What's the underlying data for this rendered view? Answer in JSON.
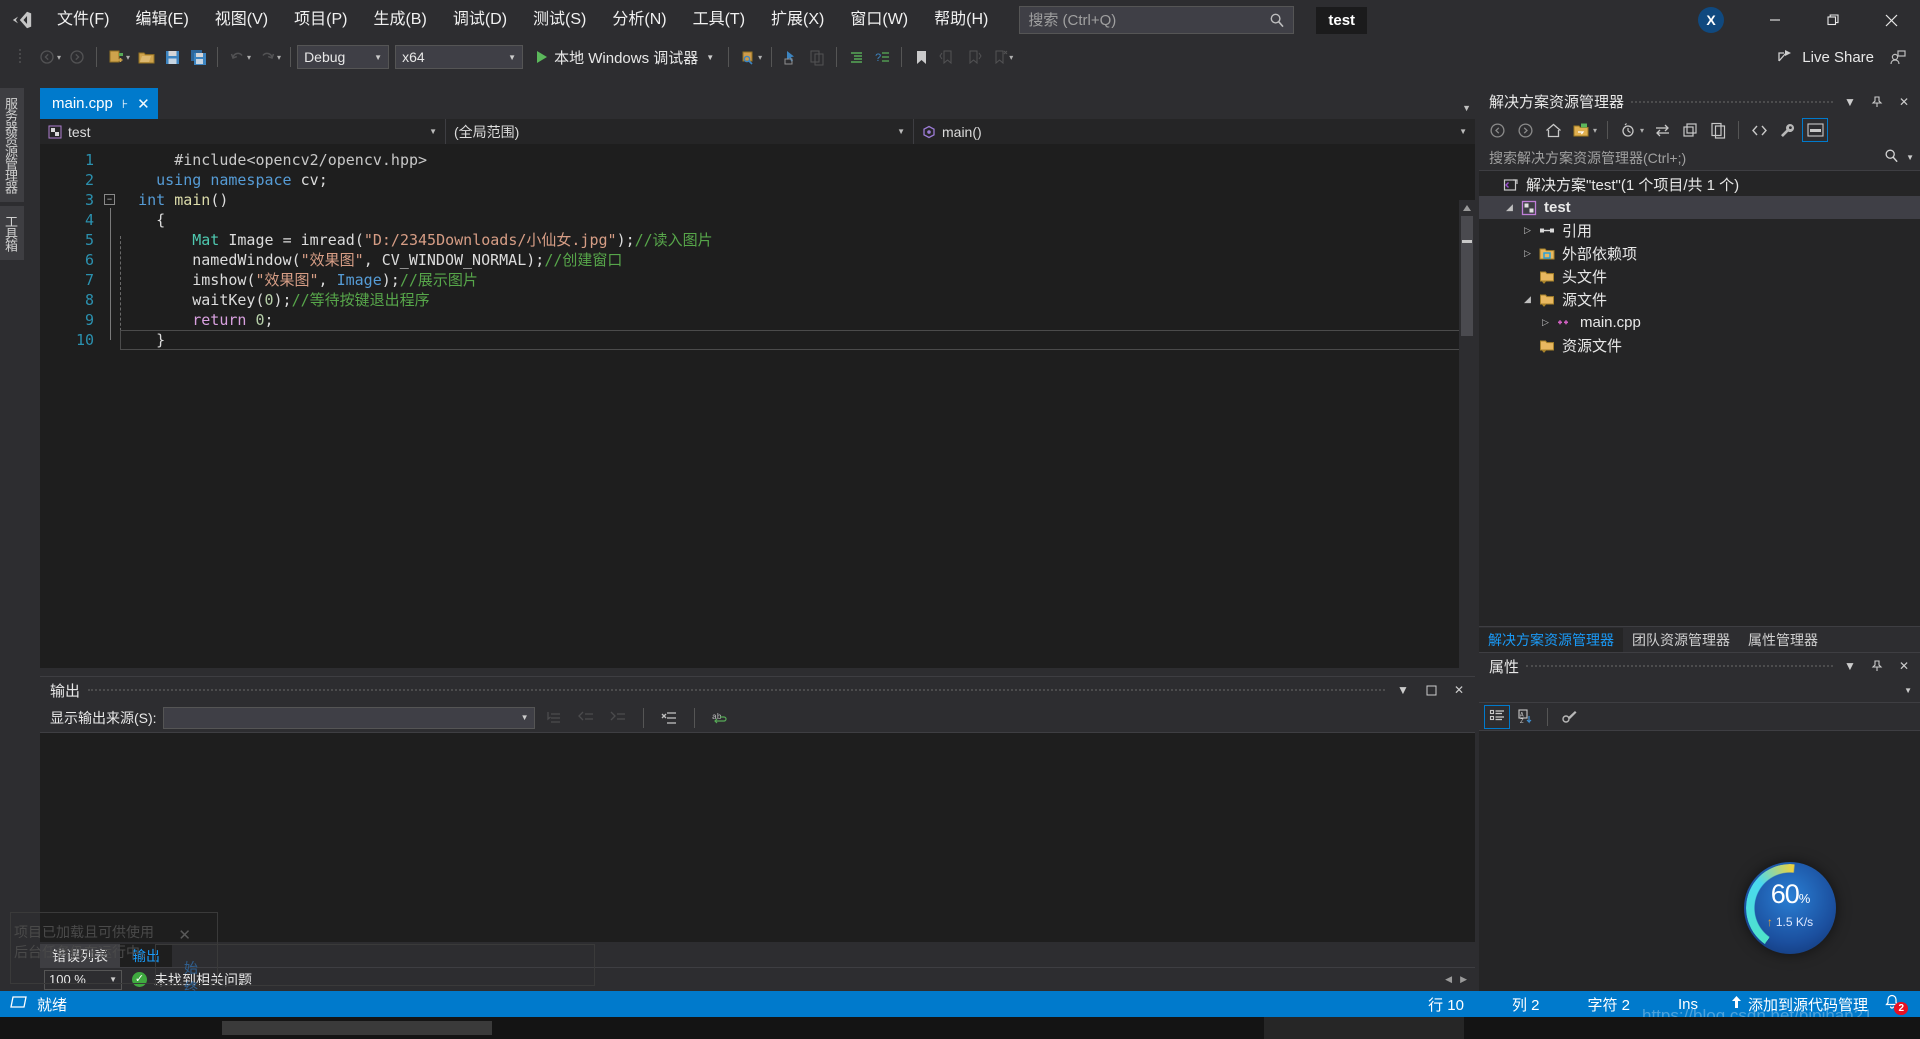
{
  "titlebar": {
    "logo_icon": "visual-studio-logo-icon",
    "menus": [
      {
        "label": "文件(F)"
      },
      {
        "label": "编辑(E)"
      },
      {
        "label": "视图(V)"
      },
      {
        "label": "项目(P)"
      },
      {
        "label": "生成(B)"
      },
      {
        "label": "调试(D)"
      },
      {
        "label": "测试(S)"
      },
      {
        "label": "分析(N)"
      },
      {
        "label": "工具(T)"
      },
      {
        "label": "扩展(X)"
      },
      {
        "label": "窗口(W)"
      },
      {
        "label": "帮助(H)"
      }
    ],
    "search_placeholder": "搜索 (Ctrl+Q)",
    "search_value": "",
    "search_icon": "search-icon",
    "project_chip": "test",
    "account_initial": "X",
    "minimize_icon": "minimize-icon",
    "maximize_icon": "restore-icon",
    "close_icon": "close-icon"
  },
  "toolbar": {
    "config": "Debug",
    "platform": "x64",
    "run_label": "本地 Windows 调试器",
    "live_share_label": "Live Share",
    "live_share_icon": "live-share-icon",
    "back_icon": "nav-back-icon",
    "forward_icon": "nav-forward-icon",
    "new_item_icon": "new-item-icon",
    "open_icon": "open-folder-icon",
    "save_icon": "save-icon",
    "save_all_icon": "save-all-icon",
    "undo_icon": "undo-icon",
    "redo_icon": "redo-icon",
    "play_icon": "play-icon",
    "bookmark_icon": "bookmark-icon",
    "pin_icon": "pin-icon"
  },
  "left_strip": {
    "tabs": [
      {
        "label": "服务器资源管理器"
      },
      {
        "label": "工具箱"
      }
    ]
  },
  "editor": {
    "tab": {
      "title": "main.cpp",
      "pin_icon": "pin-icon",
      "close_icon": "close-icon"
    },
    "nav": {
      "project": "test",
      "project_icon": "cpp-project-icon",
      "scope": "(全局范围)",
      "member": "main()",
      "member_icon": "method-icon"
    },
    "lines": [
      "1",
      "2",
      "3",
      "4",
      "5",
      "6",
      "7",
      "8",
      "9",
      "10"
    ],
    "code": [
      {
        "tokens": [
          {
            "t": "#include",
            "c": "k-macro"
          },
          {
            "t": "<opencv2/opencv.hpp>",
            "c": "k-macro"
          }
        ],
        "indent": 3
      },
      {
        "tokens": [
          {
            "t": "using ",
            "c": "k-kw"
          },
          {
            "t": "namespace ",
            "c": "k-kw"
          },
          {
            "t": "cv",
            "c": "k-pl"
          },
          {
            "t": ";",
            "c": "k-pl"
          }
        ],
        "indent": 2
      },
      {
        "tokens": [
          {
            "t": "int ",
            "c": "k-kw"
          },
          {
            "t": "main",
            "c": "k-fn"
          },
          {
            "t": "()",
            "c": "k-pl"
          }
        ],
        "indent": 1
      },
      {
        "tokens": [
          {
            "t": "{",
            "c": "k-pl"
          }
        ],
        "indent": 2
      },
      {
        "tokens": [
          {
            "t": "Mat ",
            "c": "k-type"
          },
          {
            "t": "Image ",
            "c": "k-pl"
          },
          {
            "t": "= ",
            "c": "k-pl"
          },
          {
            "t": "imread",
            "c": "k-pl"
          },
          {
            "t": "(",
            "c": "k-pl"
          },
          {
            "t": "\"D:/2345Downloads/小仙女.jpg\"",
            "c": "k-str"
          },
          {
            "t": ");",
            "c": "k-pl"
          },
          {
            "t": "//读入图片",
            "c": "k-cmt"
          }
        ],
        "indent": 4
      },
      {
        "tokens": [
          {
            "t": "namedWindow",
            "c": "k-pl"
          },
          {
            "t": "(",
            "c": "k-pl"
          },
          {
            "t": "\"效果图\"",
            "c": "k-str"
          },
          {
            "t": ", ",
            "c": "k-pl"
          },
          {
            "t": "CV_WINDOW_NORMAL",
            "c": "k-pl"
          },
          {
            "t": ");",
            "c": "k-pl"
          },
          {
            "t": "//创建窗口",
            "c": "k-cmt"
          }
        ],
        "indent": 4
      },
      {
        "tokens": [
          {
            "t": "imshow",
            "c": "k-pl"
          },
          {
            "t": "(",
            "c": "k-pl"
          },
          {
            "t": "\"效果图\"",
            "c": "k-str"
          },
          {
            "t": ", ",
            "c": "k-pl"
          },
          {
            "t": "Image",
            "c": "k-kw"
          },
          {
            "t": ");",
            "c": "k-pl"
          },
          {
            "t": "//展示图片",
            "c": "k-cmt"
          }
        ],
        "indent": 4
      },
      {
        "tokens": [
          {
            "t": "waitKey",
            "c": "k-pl"
          },
          {
            "t": "(",
            "c": "k-pl"
          },
          {
            "t": "0",
            "c": "k-num"
          },
          {
            "t": ");",
            "c": "k-pl"
          },
          {
            "t": "//等待按键退出程序",
            "c": "k-cmt"
          }
        ],
        "indent": 4
      },
      {
        "tokens": [
          {
            "t": "return ",
            "c": "k-kw2"
          },
          {
            "t": "0",
            "c": "k-num"
          },
          {
            "t": ";",
            "c": "k-pl"
          }
        ],
        "indent": 4
      },
      {
        "tokens": [
          {
            "t": "}",
            "c": "k-pl"
          }
        ],
        "indent": 2
      }
    ]
  },
  "output_panel": {
    "title": "输出",
    "source_label": "显示输出来源(S):",
    "source_value": "",
    "dropdown_icon": "chevron-down-icon",
    "minimize_icon": "window-minimize-icon",
    "maximize_icon": "window-maximize-icon",
    "close_icon": "close-icon",
    "body_text": ""
  },
  "bottom": {
    "tabs": [
      {
        "label": "错误列表",
        "active": false
      },
      {
        "label": "输出",
        "active": true
      }
    ],
    "zoom_level": "100 %",
    "status_message": "未找到相关问题",
    "check_icon": "check-circle-icon"
  },
  "notification": {
    "line1": "项目已加载且可供使用",
    "line2": "后台任务仍在运行中。",
    "ignore_label": "始终忽略",
    "close_icon": "close-icon"
  },
  "solution_explorer": {
    "title": "解决方案资源管理器",
    "dropdown_icon": "chevron-down-icon",
    "pin_icon": "pin-icon",
    "close_icon": "close-icon",
    "toolbar_icons": [
      "nav-back-icon",
      "nav-forward-icon",
      "home-icon",
      "new-solution-view-icon",
      "pending-changes-icon",
      "sync-icon",
      "collapse-all-icon",
      "copy-icon",
      "show-all-files-icon",
      "properties-wrench-icon",
      "preview-pane-icon"
    ],
    "search_placeholder": "搜索解决方案资源管理器(Ctrl+;)",
    "search_value": "",
    "search_icon": "search-icon",
    "tree": [
      {
        "label": "解决方案\"test\"(1 个项目/共 1 个)",
        "depth": 0,
        "twist": "",
        "icon": "solution-icon",
        "selected": false
      },
      {
        "label": "test",
        "depth": 1,
        "twist": "expanded",
        "icon": "cpp-project-icon",
        "selected": true
      },
      {
        "label": "引用",
        "depth": 2,
        "twist": "collapsed",
        "icon": "references-icon",
        "selected": false
      },
      {
        "label": "外部依赖项",
        "depth": 2,
        "twist": "collapsed",
        "icon": "ext-deps-icon",
        "selected": false
      },
      {
        "label": "头文件",
        "depth": 2,
        "twist": "",
        "icon": "folder-filter-icon",
        "selected": false
      },
      {
        "label": "源文件",
        "depth": 2,
        "twist": "expanded",
        "icon": "folder-filter-icon",
        "selected": false
      },
      {
        "label": "main.cpp",
        "depth": 3,
        "twist": "collapsed",
        "icon": "cpp-file-icon",
        "selected": false
      },
      {
        "label": "资源文件",
        "depth": 2,
        "twist": "",
        "icon": "folder-filter-icon",
        "selected": false
      }
    ],
    "tabs": [
      {
        "label": "解决方案资源管理器",
        "active": true
      },
      {
        "label": "团队资源管理器",
        "active": false
      },
      {
        "label": "属性管理器",
        "active": false
      }
    ]
  },
  "properties_panel": {
    "title": "属性",
    "dropdown_icon": "chevron-down-icon",
    "pin_icon": "pin-icon",
    "close_icon": "close-icon",
    "object_value": "",
    "toolbar_icons": [
      "categorized-icon",
      "alphabetical-icon",
      "property-pages-icon"
    ]
  },
  "statusbar": {
    "ready": "就绪",
    "ready_icon": "source-control-icon",
    "line": "行 10",
    "col": "列 2",
    "char": "字符 2",
    "insert_mode": "Ins",
    "add_to_source_control": "添加到源代码管理",
    "add_icon": "up-arrow-icon",
    "bell_icon": "notification-bell-icon",
    "bell_count": "2"
  },
  "perf_widget": {
    "percent": "60",
    "percent_unit": "%",
    "rate": "1.5 K/s",
    "arrow_icon": "up-arrow-icon"
  },
  "watermark": {
    "text": "https://blog.csdn.net/pipihan21"
  },
  "colors": {
    "accent": "#007acc",
    "chrome": "#2d2d30",
    "editor_bg": "#1e1e1e",
    "panel_bg": "#252526",
    "comment": "#57a64a",
    "string": "#d69d85",
    "keyword": "#569cd6",
    "type": "#4ec9b0"
  }
}
